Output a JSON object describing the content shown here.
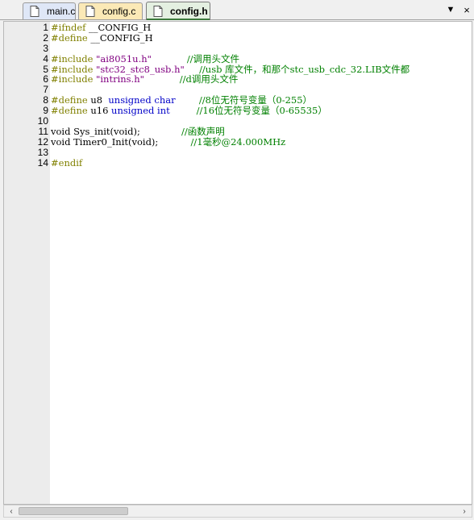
{
  "tabs": [
    {
      "label": "main.c"
    },
    {
      "label": "config.c"
    },
    {
      "label": "config.h"
    }
  ],
  "tab_controls": {
    "dropdown": "▼",
    "close": "×"
  },
  "lines": [
    {
      "n": "1",
      "parts": [
        {
          "t": "#ifndef",
          "c": "pp"
        },
        {
          "t": " __CONFIG_H",
          "c": "plain"
        }
      ]
    },
    {
      "n": "2",
      "parts": [
        {
          "t": "#define",
          "c": "pp"
        },
        {
          "t": " __CONFIG_H",
          "c": "plain"
        }
      ]
    },
    {
      "n": "3",
      "parts": []
    },
    {
      "n": "4",
      "parts": [
        {
          "t": "#include",
          "c": "pp"
        },
        {
          "t": " ",
          "c": "plain"
        },
        {
          "t": "\"ai8051u.h\"",
          "c": "str"
        },
        {
          "t": "            ",
          "c": "plain"
        },
        {
          "t": "//调用头文件",
          "c": "cmt"
        }
      ]
    },
    {
      "n": "5",
      "parts": [
        {
          "t": "#include",
          "c": "pp"
        },
        {
          "t": " ",
          "c": "plain"
        },
        {
          "t": "\"stc32_stc8_usb.h\"",
          "c": "str"
        },
        {
          "t": "     ",
          "c": "plain"
        },
        {
          "t": "//usb 库文件，和那个stc_usb_cdc_32.LIB文件都",
          "c": "cmt"
        }
      ]
    },
    {
      "n": "6",
      "parts": [
        {
          "t": "#include",
          "c": "pp"
        },
        {
          "t": " ",
          "c": "plain"
        },
        {
          "t": "\"intrins.h\"",
          "c": "str"
        },
        {
          "t": "            ",
          "c": "plain"
        },
        {
          "t": "//d调用头文件",
          "c": "cmt"
        }
      ]
    },
    {
      "n": "7",
      "parts": []
    },
    {
      "n": "8",
      "parts": [
        {
          "t": "#define",
          "c": "pp"
        },
        {
          "t": " u8  ",
          "c": "plain"
        },
        {
          "t": "unsigned char",
          "c": "kw"
        },
        {
          "t": "        ",
          "c": "plain"
        },
        {
          "t": "//8位无符号变量（0-255）",
          "c": "cmt"
        }
      ]
    },
    {
      "n": "9",
      "parts": [
        {
          "t": "#define",
          "c": "pp"
        },
        {
          "t": " u16 ",
          "c": "plain"
        },
        {
          "t": "unsigned int",
          "c": "kw"
        },
        {
          "t": "         ",
          "c": "plain"
        },
        {
          "t": "//16位无符号变量（0-65535）",
          "c": "cmt"
        }
      ]
    },
    {
      "n": "10",
      "parts": []
    },
    {
      "n": "11",
      "parts": [
        {
          "t": "void Sys_init(void);",
          "c": "plain"
        },
        {
          "t": "              ",
          "c": "plain"
        },
        {
          "t": "//函数声明",
          "c": "cmt"
        }
      ]
    },
    {
      "n": "12",
      "parts": [
        {
          "t": "void Timer0_Init(void);",
          "c": "plain"
        },
        {
          "t": "           ",
          "c": "plain"
        },
        {
          "t": "//1毫秒@24.000MHz",
          "c": "cmt"
        }
      ]
    },
    {
      "n": "13",
      "parts": []
    },
    {
      "n": "14",
      "parts": [
        {
          "t": "#endif",
          "c": "pp"
        }
      ]
    }
  ],
  "scrollbar": {
    "left": "‹",
    "right": "›"
  }
}
